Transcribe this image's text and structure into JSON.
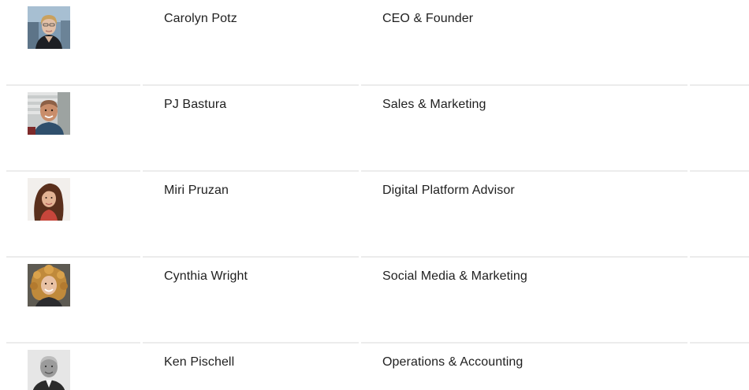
{
  "team": {
    "members": [
      {
        "name": "Carolyn Potz",
        "role": "CEO & Founder",
        "photo_icon": "carolyn-potz-photo"
      },
      {
        "name": "PJ Bastura",
        "role": "Sales & Marketing",
        "photo_icon": "pj-bastura-photo"
      },
      {
        "name": "Miri Pruzan",
        "role": "Digital Platform Advisor",
        "photo_icon": "miri-pruzan-photo"
      },
      {
        "name": "Cynthia Wright",
        "role": "Social Media & Marketing",
        "photo_icon": "cynthia-wright-photo"
      },
      {
        "name": "Ken Pischell",
        "role": "Operations & Accounting",
        "photo_icon": "ken-pischell-photo"
      }
    ]
  },
  "colors": {
    "text": "#1f1f1f",
    "divider": "#ececec",
    "background": "#ffffff"
  }
}
